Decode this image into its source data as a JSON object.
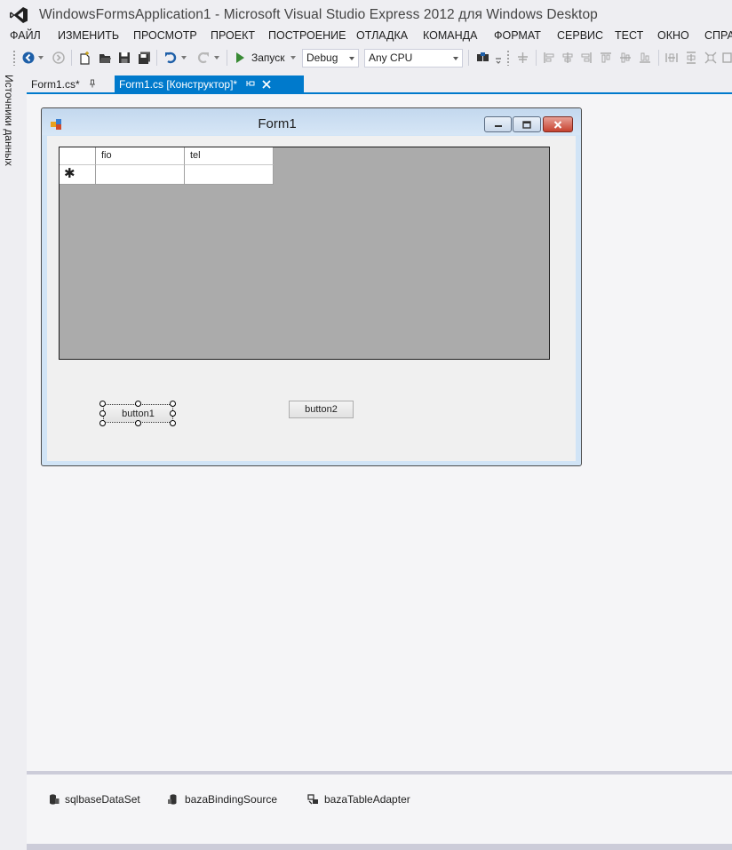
{
  "window": {
    "title": "WindowsFormsApplication1 - Microsoft Visual Studio Express 2012 для Windows Desktop"
  },
  "menu": [
    {
      "label": "ФАЙЛ"
    },
    {
      "label": "ИЗМЕНИТЬ"
    },
    {
      "label": "ПРОСМОТР"
    },
    {
      "label": "ПРОЕКТ"
    },
    {
      "label": "ПОСТРОЕНИЕ"
    },
    {
      "label": "ОТЛАДКА"
    },
    {
      "label": "КОМАНДА"
    },
    {
      "label": "ФОРМАТ"
    },
    {
      "label": "СЕРВИС"
    },
    {
      "label": "ТЕСТ"
    },
    {
      "label": "ОКНО"
    },
    {
      "label": "СПРА"
    }
  ],
  "toolbar": {
    "run_label": "Запуск",
    "configuration": "Debug",
    "platform": "Any CPU"
  },
  "side_panel": {
    "label": "Источники данных"
  },
  "tabs": [
    {
      "label": "Form1.cs*",
      "active": false
    },
    {
      "label": "Form1.cs [Конструктор]*",
      "active": true
    }
  ],
  "form": {
    "title": "Form1",
    "grid": {
      "columns": [
        "fio",
        "tel"
      ],
      "new_row_marker": "✱"
    },
    "buttons": [
      {
        "label": "button1",
        "selected": true
      },
      {
        "label": "button2",
        "selected": false
      }
    ]
  },
  "tray": [
    {
      "label": "sqlbaseDataSet",
      "icon": "dataset-icon"
    },
    {
      "label": "bazaBindingSource",
      "icon": "binding-source-icon"
    },
    {
      "label": "bazaTableAdapter",
      "icon": "table-adapter-icon"
    }
  ],
  "colors": {
    "accent": "#007acc",
    "run_green": "#388a34",
    "grid_background": "#ababab"
  }
}
